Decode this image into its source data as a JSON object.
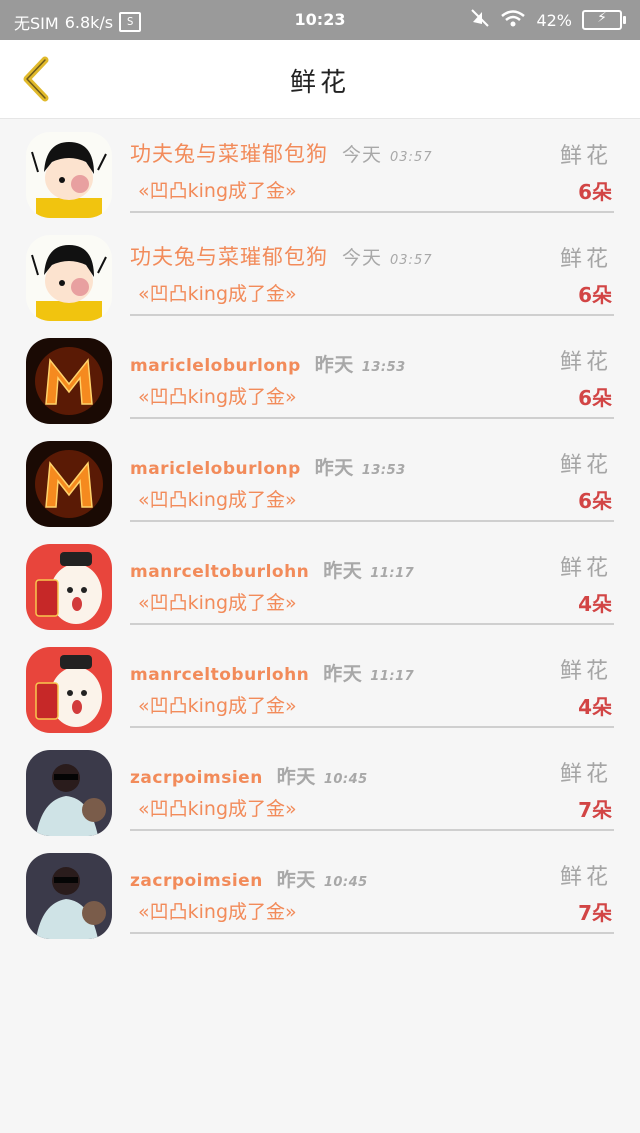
{
  "status_bar": {
    "carrier": "无SIM",
    "speed": "6.8k/s",
    "s_badge": "S",
    "time": "10:23",
    "battery": "42%"
  },
  "header": {
    "title": "鲜花"
  },
  "rows": [
    {
      "name": "功夫兔与菜璀郁包狗",
      "day": "今天",
      "clock": "03:57",
      "flower_label": "鲜花",
      "song": "«凹凸king成了金»",
      "count": "6朵"
    },
    {
      "name": "功夫兔与菜璀郁包狗",
      "day": "今天",
      "clock": "03:57",
      "flower_label": "鲜花",
      "song": "«凹凸king成了金»",
      "count": "6朵"
    },
    {
      "name": "maricleloburlonp",
      "day": "昨天",
      "clock": "13:53",
      "flower_label": "鲜花",
      "song": "«凹凸king成了金»",
      "count": "6朵"
    },
    {
      "name": "maricleloburlonp",
      "day": "昨天",
      "clock": "13:53",
      "flower_label": "鲜花",
      "song": "«凹凸king成了金»",
      "count": "6朵"
    },
    {
      "name": "manrceltoburlohn",
      "day": "昨天",
      "clock": "11:17",
      "flower_label": "鲜花",
      "song": "«凹凸king成了金»",
      "count": "4朵"
    },
    {
      "name": "manrceltoburlohn",
      "day": "昨天",
      "clock": "11:17",
      "flower_label": "鲜花",
      "song": "«凹凸king成了金»",
      "count": "4朵"
    },
    {
      "name": "zacrpoimsien",
      "day": "昨天",
      "clock": "10:45",
      "flower_label": "鲜花",
      "song": "«凹凸king成了金»",
      "count": "7朵"
    },
    {
      "name": "zacrpoimsien",
      "day": "昨天",
      "clock": "10:45",
      "flower_label": "鲜花",
      "song": "«凹凸king成了金»",
      "count": "7朵"
    }
  ],
  "colors": {
    "accent": "#f28b5a",
    "count": "#d24545",
    "muted": "#a5a5a5",
    "back_arrow": "#e0b92b"
  }
}
